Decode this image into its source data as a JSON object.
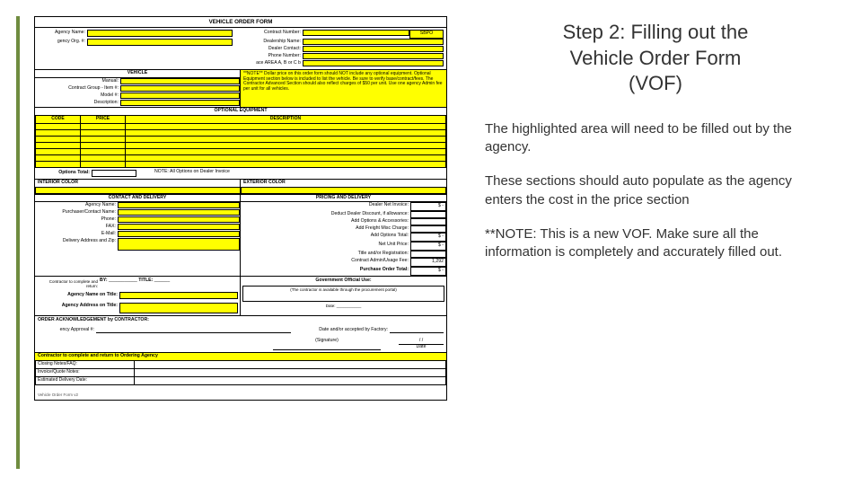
{
  "form": {
    "title": "VEHICLE ORDER FORM",
    "top_left_labels": {
      "agency_name": "Agency Name:",
      "agency_org": "gency Org. #:"
    },
    "top_right_labels": {
      "contract_no": "Contract Number:",
      "dealership": "Dealership Name:",
      "dealer_contact": "Dealer Contact:",
      "phone": "Phone Number:",
      "area": "ace AREA A, B or C b"
    },
    "sbpo": "SBPO",
    "vehicle_header": "VEHICLE",
    "vehicle_labels": {
      "manual": "Manual:",
      "contract_group": "Contract Group - Item #:",
      "model": "Model #:",
      "desc": "Description:"
    },
    "note_box": "**NOTE** Dollar price on this order form should NOT include any optional equipment. Optional Equipment section below is included to list the vehicle. Be sure to verify base/contract/fees. The Contractor Advanced Section should also reflect charges of $50 per unit. Use one agency Admin fee per unit for all vehicles.",
    "optional_header": "OPTIONAL EQUIPMENT",
    "optional_cols": {
      "code": "CODE",
      "price": "PRICE",
      "description": "DESCRIPTION"
    },
    "options_total": "Options Total:",
    "options_note": "NOTE: All Options on Dealer Invoice",
    "interior": "INTERIOR COLOR",
    "exterior": "EXTERIOR COLOR",
    "contact_header": "CONTACT AND DELIVERY",
    "contact_labels": {
      "agency_name": "Agency Name:",
      "purchaser": "Purchaser/Contact Name:",
      "phone": "Phone:",
      "fax": "FAX:",
      "email": "E-Mail:",
      "delivery": "Delivery Address and Zip:"
    },
    "pricing_header": "PRICING AND DELIVERY",
    "pricing_rows": {
      "r1": "Dealer Net Invoice:",
      "r2": "Deduct Dealer Discount, if allowance:",
      "r3": "Add Options & Accessories:",
      "r4": "Add Freight Misc Charge:",
      "r5": "Add Options Total:",
      "r6": "Net Unit Price:",
      "r7": "Title and/or Registration:",
      "r8": "Contract Admin/Usage Fee:",
      "r9": "Purchase Order Total:"
    },
    "admin_fee": "1,292",
    "dashes": "$   -",
    "contractor_complete": "Contractor to complete and return to Ordering Agency",
    "contractor_rows": {
      "r1": "Closing Notes/FAQ:",
      "r2": "Invoice/Quote Notes:",
      "r3": "Estimated Delivery Date:"
    },
    "official_use": "Government Official Use:",
    "official_text": "(The contractor is available through the procurement portal)",
    "sign_labels": {
      "by": "BY:",
      "title": "TITLE:",
      "date": "/ /",
      "sig": "(Signature)",
      "datel": "Date"
    },
    "order_ack": "ORDER ACKNOWLEDGEMENT by CONTRACTOR:",
    "agency_approve": "ency Approval #:",
    "approved_by": "Date and/or accepted by Factory:",
    "agency_on_title": "Agency Name on Title:",
    "agency_address": "Agency Address on Title:",
    "footer_note": "Vehicle Order Form v2"
  },
  "right": {
    "title_l1": "Step 2:  Filling out the",
    "title_l2": "Vehicle Order Form",
    "title_l3": "(VOF)",
    "p1": "The highlighted area will need to be filled out by the agency.",
    "p2": "These sections should auto populate as the agency enters the cost in the price section",
    "p3": "**NOTE:  This is a new VOF.  Make sure all the information is completely and accurately filled out."
  }
}
